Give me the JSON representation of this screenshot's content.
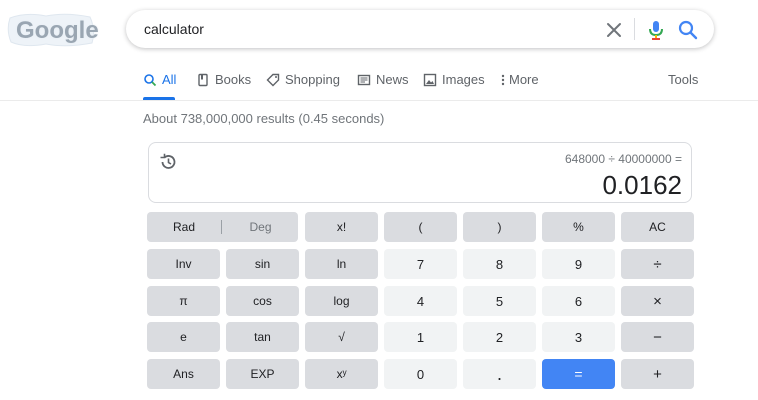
{
  "logo": {
    "text": "Google"
  },
  "search": {
    "query": "calculator"
  },
  "icons": {
    "clear": "close-icon",
    "mic": "microphone-icon",
    "search": "search-icon",
    "history": "history-icon"
  },
  "tabs": [
    {
      "label": "All",
      "icon": "search-icon",
      "active": true
    },
    {
      "label": "Books",
      "icon": "book-icon"
    },
    {
      "label": "Shopping",
      "icon": "tag-icon"
    },
    {
      "label": "News",
      "icon": "newspaper-icon"
    },
    {
      "label": "Images",
      "icon": "image-icon"
    },
    {
      "label": "More",
      "icon": "vertical-dots-icon"
    }
  ],
  "tools": "Tools",
  "result_stats": "About 738,000,000 results (0.45 seconds)",
  "calculator": {
    "expression": "648000 ÷ 40000000 =",
    "result": "0.0162",
    "mode_rad": "Rad",
    "mode_deg": "Deg",
    "keys": {
      "fact": "x!",
      "lparen": "(",
      "rparen": ")",
      "percent": "%",
      "ac": "AC",
      "inv": "Inv",
      "sin": "sin",
      "ln": "ln",
      "seven": "7",
      "eight": "8",
      "nine": "9",
      "divide": "÷",
      "pi": "π",
      "cos": "cos",
      "log": "log",
      "four": "4",
      "five": "5",
      "six": "6",
      "multiply": "×",
      "e": "e",
      "tan": "tan",
      "sqrt": "√",
      "one": "1",
      "two": "2",
      "three": "3",
      "minus": "−",
      "ans": "Ans",
      "exp": "EXP",
      "power": "xʸ",
      "zero": "0",
      "dot": ".",
      "equals": "=",
      "plus": "+"
    }
  },
  "colors": {
    "accent": "#1a73e8",
    "equals_key": "#4285f4",
    "func_key": "#dadce0",
    "num_key": "#f1f3f4"
  }
}
